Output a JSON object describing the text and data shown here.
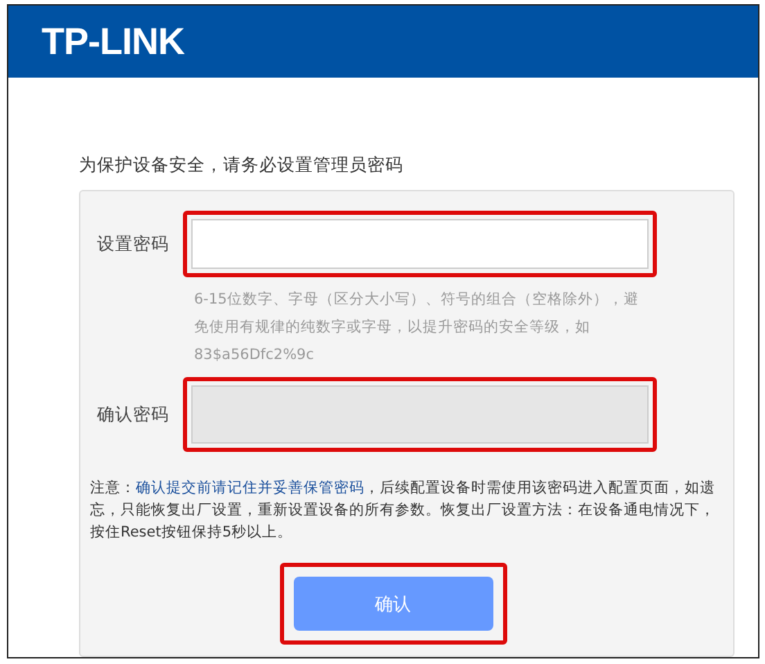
{
  "header": {
    "logo": "TP-LINK"
  },
  "heading": "为保护设备安全，请务必设置管理员密码",
  "fields": [
    {
      "label": "设置密码",
      "disabled": false,
      "highlighted": true,
      "hint": "6-15位数字、字母（区分大小写）、符号的组合（空格除外），避免使用有规律的纯数字或字母，以提升密码的安全等级，如83$a56Dfc2%9c"
    },
    {
      "label": "确认密码",
      "disabled": true,
      "highlighted": true
    }
  ],
  "note": {
    "prefix": "注意：",
    "emphasis": "确认提交前请记住并妥善保管密码",
    "rest": "，后续配置设备时需使用该密码进入配置页面，如遗忘，只能恢复出厂设置，重新设置设备的所有参数。恢复出厂设置方法：在设备通电情况下，按住Reset按钮保持5秒以上。"
  },
  "confirm_button": {
    "label": "确认",
    "highlighted": true
  }
}
